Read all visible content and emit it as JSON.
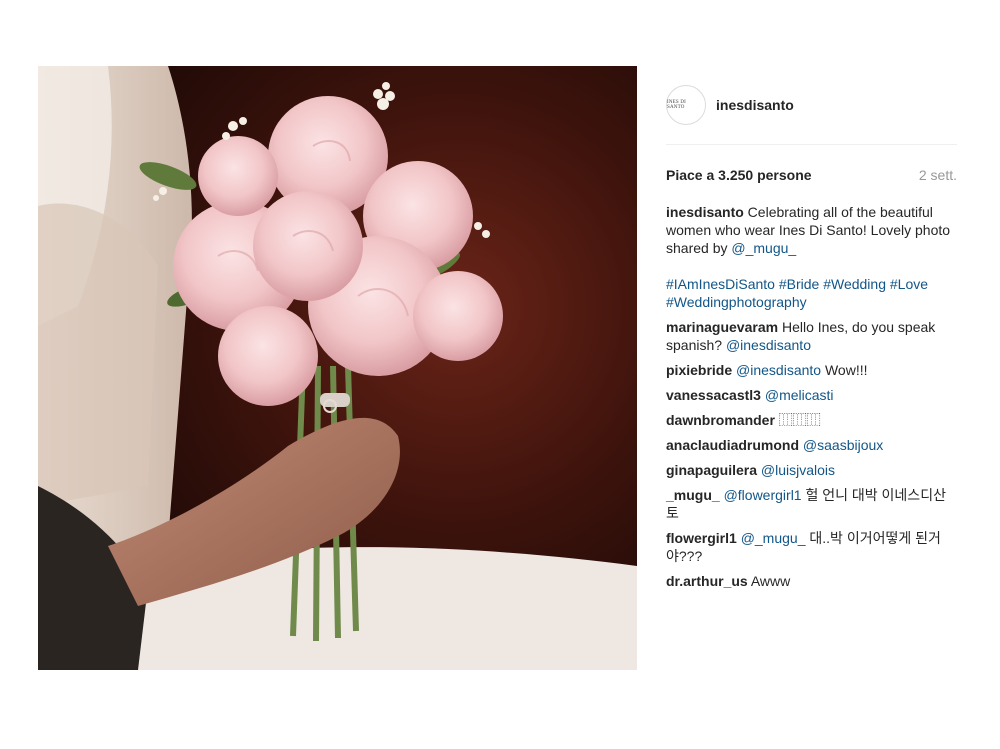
{
  "post": {
    "username": "inesdisanto",
    "avatar_text": "INES DI SANTO",
    "likes": "Piace a 3.250 persone",
    "date": "2 sett.",
    "caption_user": "inesdisanto",
    "caption_text": " Celebrating all of the beautiful women who wear Ines Di Santo! Lovely photo shared by ",
    "caption_mention": "@_mugu_",
    "hashtags": "#IAmInesDiSanto #Bride #Wedding #Love #Weddingphotography"
  },
  "comments": [
    {
      "user": "marinaguevaram",
      "text": " Hello Ines, do you speak spanish? ",
      "mention": "@inesdisanto",
      "after": ""
    },
    {
      "user": "pixiebride",
      "text": " ",
      "mention": "@inesdisanto",
      "after": " Wow!!!"
    },
    {
      "user": "vanessacastl3",
      "text": " ",
      "mention": "@melicasti",
      "after": ""
    },
    {
      "user": "dawnbromander",
      "text": " ⿲⿲⿲",
      "mention": "",
      "after": ""
    },
    {
      "user": "anaclaudiadrumond",
      "text": " ",
      "mention": "@saasbijoux",
      "after": ""
    },
    {
      "user": "ginapaguilera",
      "text": " ",
      "mention": "@luisjvalois",
      "after": ""
    },
    {
      "user": "_mugu_",
      "text": " ",
      "mention": "@flowergirl1",
      "after": " 헐 언니 대박 이네스디산토"
    },
    {
      "user": "flowergirl1",
      "text": " ",
      "mention": "@_mugu_",
      "after": " 대..박 이거어떻게 된거야???"
    },
    {
      "user": "dr.arthur_us",
      "text": " Awww",
      "mention": "",
      "after": ""
    }
  ]
}
